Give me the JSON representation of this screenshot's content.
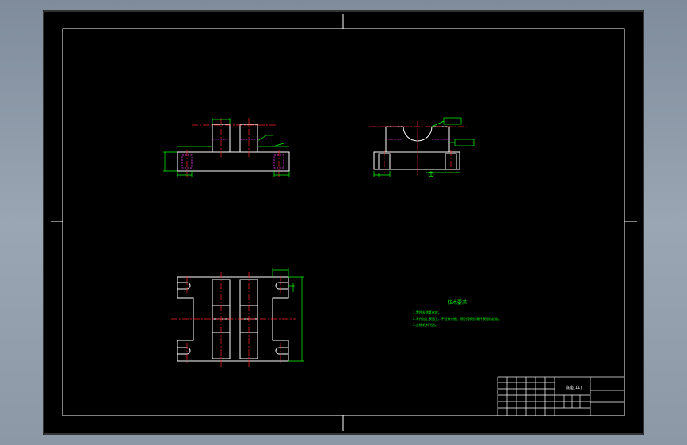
{
  "technical_requirements": {
    "title": "技术要求",
    "items": [
      "1.零件去除氧化皮。",
      "2.零件加工表面上，不应有划痕、擦伤等损伤零件表面的缺陷。",
      "3.去除毛刺飞边。"
    ]
  },
  "title_block": {
    "part_name": "底座(11)"
  },
  "colors": {
    "background": "#000000",
    "outline": "#ffffff",
    "dimension": "#00ff00",
    "center_line": "#ff2020",
    "hidden_line": "#ff40ff"
  }
}
